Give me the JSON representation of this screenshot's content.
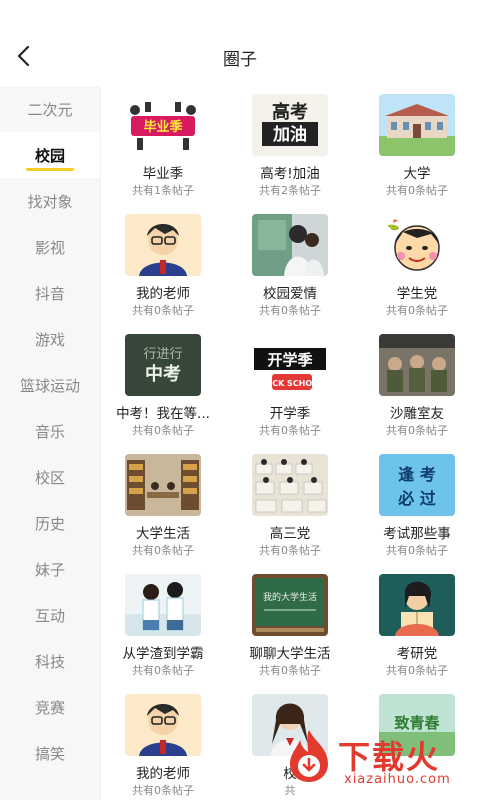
{
  "header": {
    "title": "圈子"
  },
  "sidebar": {
    "items": [
      {
        "label": "二次元",
        "active": false
      },
      {
        "label": "校园",
        "active": true
      },
      {
        "label": "找对象",
        "active": false
      },
      {
        "label": "影视",
        "active": false
      },
      {
        "label": "抖音",
        "active": false
      },
      {
        "label": "游戏",
        "active": false
      },
      {
        "label": "篮球运动",
        "active": false
      },
      {
        "label": "音乐",
        "active": false
      },
      {
        "label": "校区",
        "active": false
      },
      {
        "label": "历史",
        "active": false
      },
      {
        "label": "妹子",
        "active": false
      },
      {
        "label": "互动",
        "active": false
      },
      {
        "label": "科技",
        "active": false
      },
      {
        "label": "竞赛",
        "active": false
      },
      {
        "label": "搞笑",
        "active": false
      }
    ]
  },
  "circles": [
    {
      "name": "毕业季",
      "count": "共有1条帖子",
      "thumb": "graduation"
    },
    {
      "name": "高考!加油",
      "count": "共有2条帖子",
      "thumb": "gaokao"
    },
    {
      "name": "大学",
      "count": "共有0条帖子",
      "thumb": "campus"
    },
    {
      "name": "我的老师",
      "count": "共有0条帖子",
      "thumb": "teacher"
    },
    {
      "name": "校园爱情",
      "count": "共有0条帖子",
      "thumb": "love"
    },
    {
      "name": "学生党",
      "count": "共有0条帖子",
      "thumb": "student"
    },
    {
      "name": "中考！我在等...",
      "count": "共有0条帖子",
      "thumb": "zhongkao"
    },
    {
      "name": "开学季",
      "count": "共有0条帖子",
      "thumb": "backtoschool"
    },
    {
      "name": "沙雕室友",
      "count": "共有0条帖子",
      "thumb": "roommate"
    },
    {
      "name": "大学生活",
      "count": "共有0条帖子",
      "thumb": "library"
    },
    {
      "name": "高三党",
      "count": "共有0条帖子",
      "thumb": "classroom"
    },
    {
      "name": "考试那些事",
      "count": "共有0条帖子",
      "thumb": "exam"
    },
    {
      "name": "从学渣到学霸",
      "count": "共有0条帖子",
      "thumb": "couple"
    },
    {
      "name": "聊聊大学生活",
      "count": "共有0条帖子",
      "thumb": "blackboard"
    },
    {
      "name": "考研党",
      "count": "共有0条帖子",
      "thumb": "reading"
    },
    {
      "name": "我的老师",
      "count": "共有0条帖子",
      "thumb": "teacher"
    },
    {
      "name": "校",
      "count": "共",
      "thumb": "girl"
    },
    {
      "name": "",
      "count": "",
      "thumb": "youth"
    }
  ],
  "thumb_text": {
    "graduation": "毕业季",
    "gaokao_top": "高考",
    "gaokao_bottom": "加油",
    "zhongkao": "中考",
    "backtoschool": "开学季",
    "exam_top": "逢 考",
    "exam_bottom": "必 过",
    "blackboard": "我的大学生活",
    "youth": "致青春"
  },
  "watermark": {
    "brand": "下载火",
    "domain": "xiazaihuo.com"
  },
  "colors": {
    "accent": "#f5cd22",
    "watermark": "#e23a2e"
  }
}
